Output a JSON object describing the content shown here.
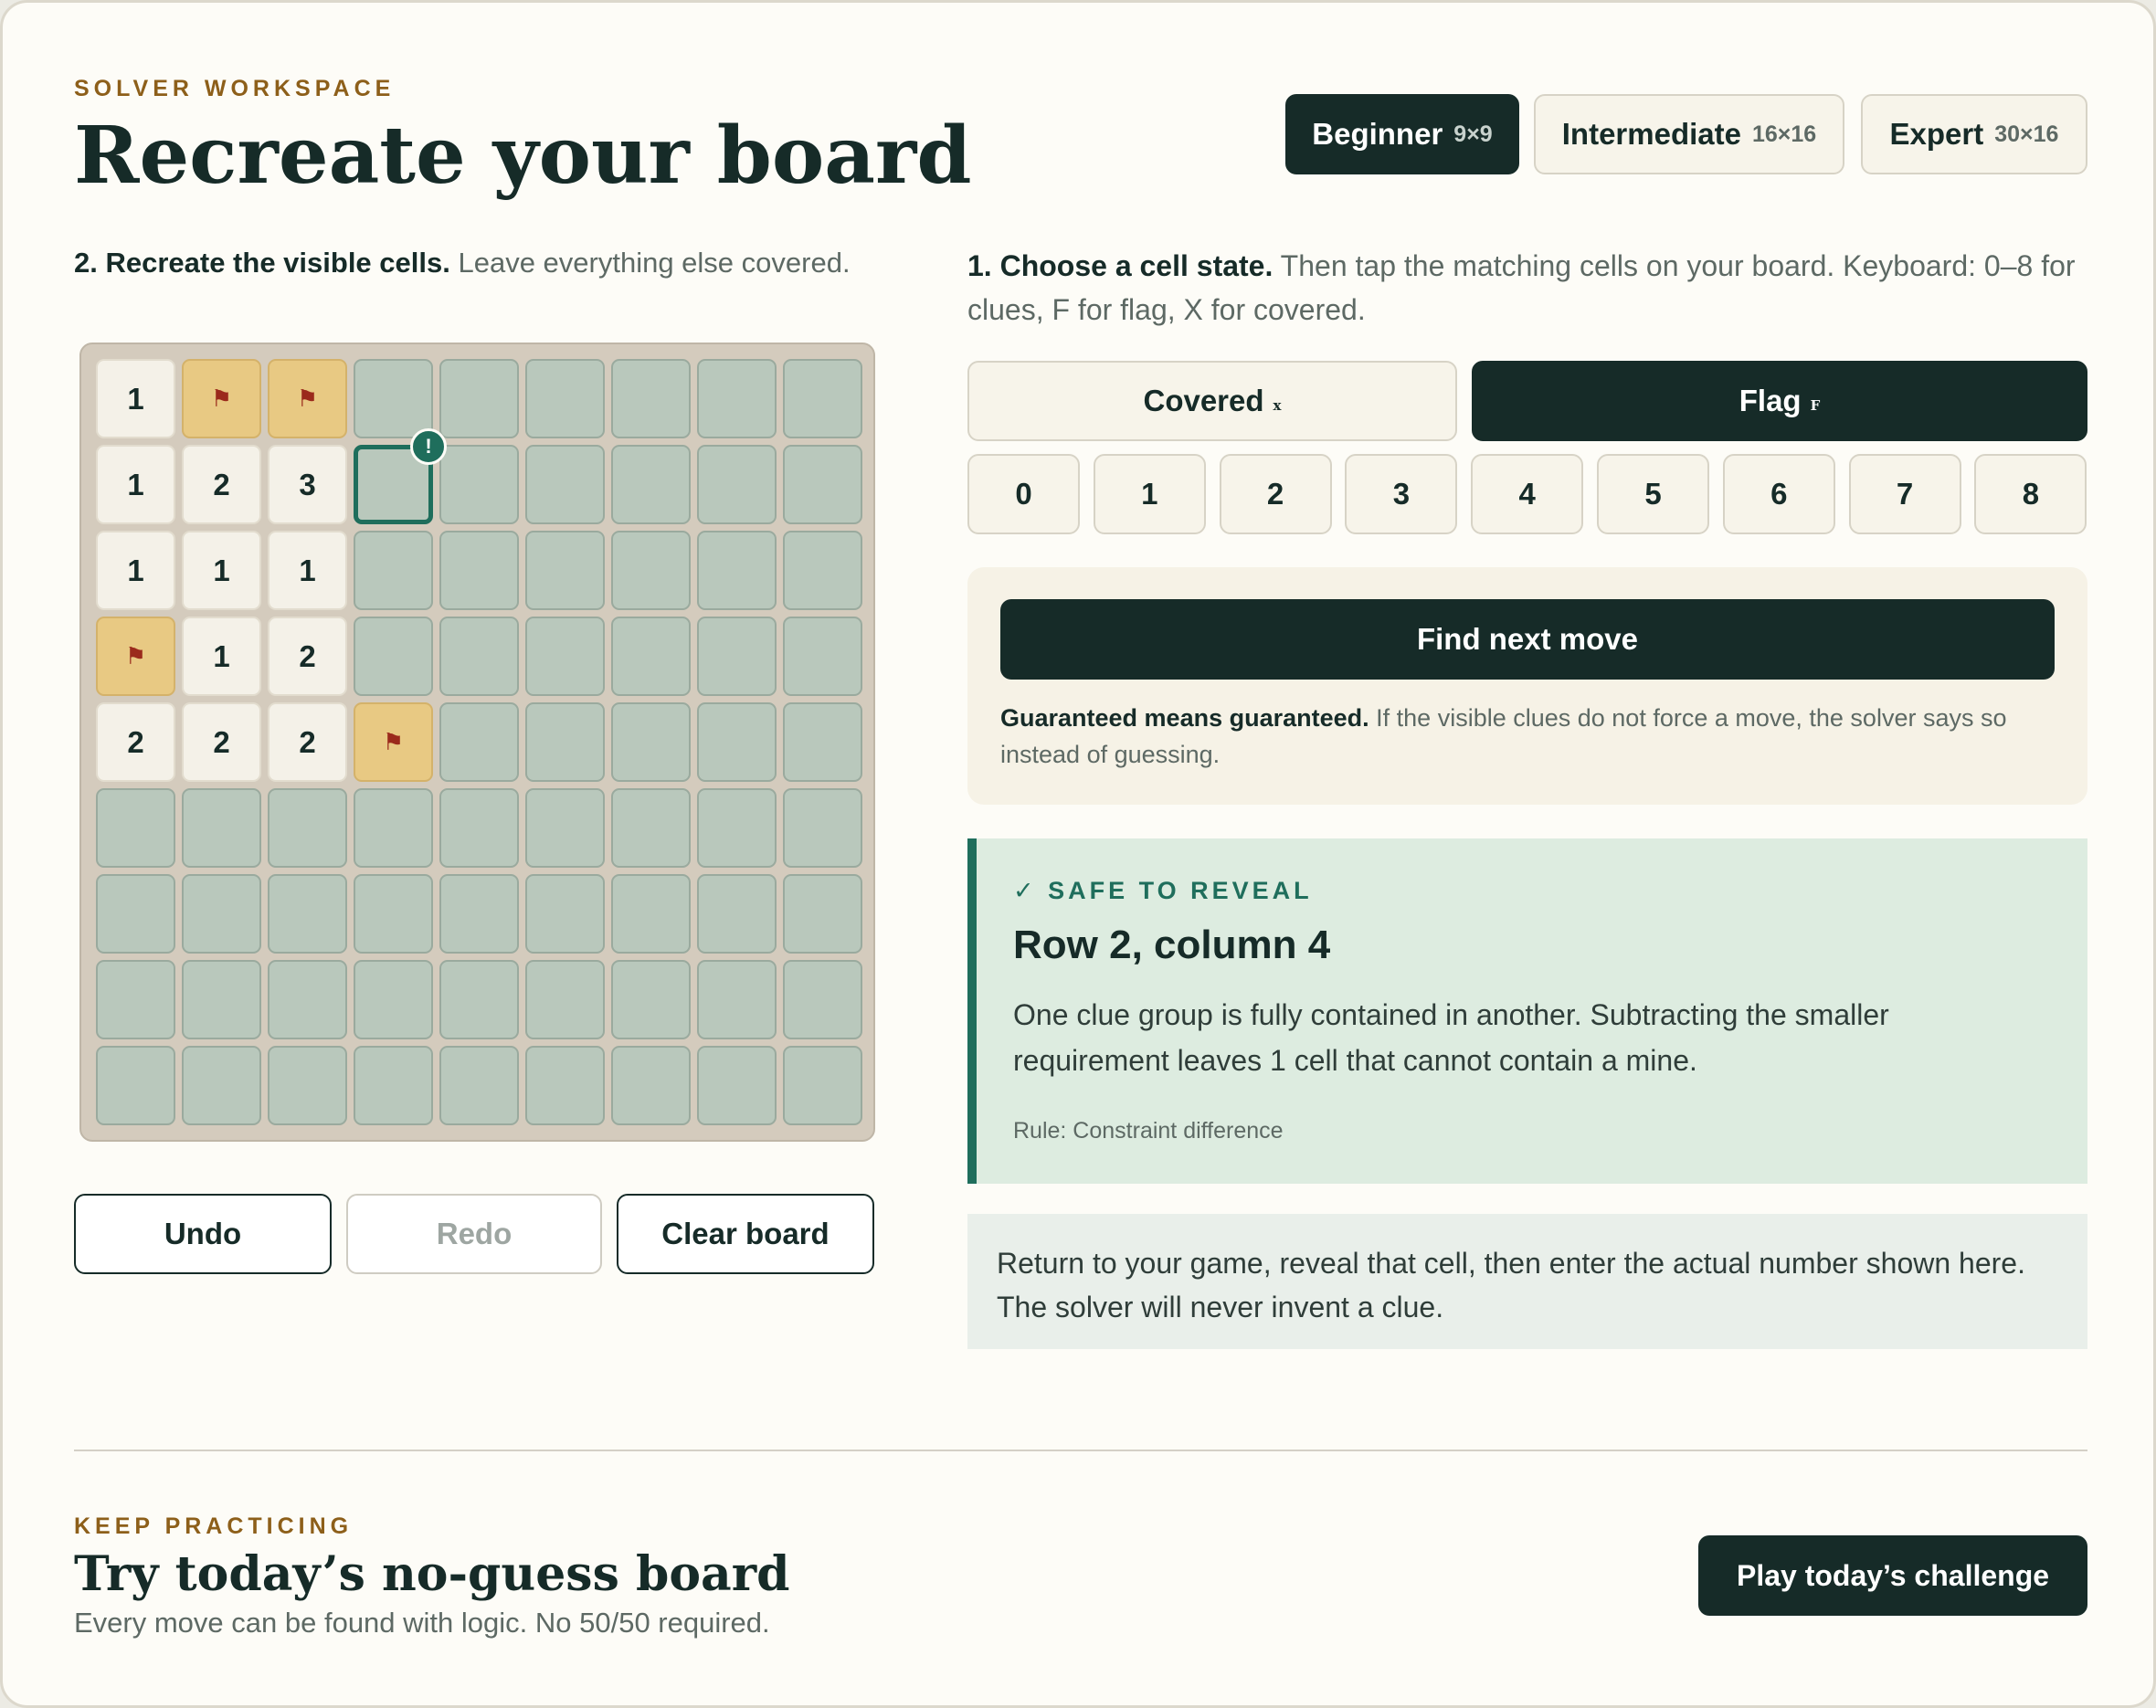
{
  "header": {
    "eyebrow": "SOLVER WORKSPACE",
    "title": "Recreate your board"
  },
  "difficulty": [
    {
      "label": "Beginner",
      "size": "9×9",
      "active": true
    },
    {
      "label": "Intermediate",
      "size": "16×16",
      "active": false
    },
    {
      "label": "Expert",
      "size": "30×16",
      "active": false
    }
  ],
  "step2": {
    "strong": "2. Recreate the visible cells.",
    "text": "Leave everything else covered."
  },
  "board": {
    "rows": [
      [
        "1",
        "F",
        "F",
        "C",
        "C",
        "C",
        "C",
        "C",
        "C"
      ],
      [
        "1",
        "2",
        "3",
        "C",
        "C",
        "C",
        "C",
        "C",
        "C"
      ],
      [
        "1",
        "1",
        "1",
        "C",
        "C",
        "C",
        "C",
        "C",
        "C"
      ],
      [
        "F",
        "1",
        "2",
        "C",
        "C",
        "C",
        "C",
        "C",
        "C"
      ],
      [
        "2",
        "2",
        "2",
        "F",
        "C",
        "C",
        "C",
        "C",
        "C"
      ],
      [
        "C",
        "C",
        "C",
        "C",
        "C",
        "C",
        "C",
        "C",
        "C"
      ],
      [
        "C",
        "C",
        "C",
        "C",
        "C",
        "C",
        "C",
        "C",
        "C"
      ],
      [
        "C",
        "C",
        "C",
        "C",
        "C",
        "C",
        "C",
        "C",
        "C"
      ],
      [
        "C",
        "C",
        "C",
        "C",
        "C",
        "C",
        "C",
        "C",
        "C"
      ]
    ],
    "flag_glyph": "⚑",
    "selected_row": 2,
    "selected_col": 4,
    "marker": "!"
  },
  "actions": {
    "undo": "Undo",
    "redo": "Redo",
    "clear": "Clear board"
  },
  "step1": {
    "strong": "1. Choose a cell state.",
    "text": "Then tap the matching cells on your board. Keyboard: 0–8 for clues, F for flag, X for covered."
  },
  "states": {
    "covered": {
      "label": "Covered",
      "key": "x"
    },
    "flag": {
      "label": "Flag",
      "key": "F"
    }
  },
  "numbers": [
    "0",
    "1",
    "2",
    "3",
    "4",
    "5",
    "6",
    "7",
    "8"
  ],
  "solver": {
    "button": "Find next move",
    "note_strong": "Guaranteed means guaranteed.",
    "note": "If the visible clues do not force a move, the solver says so instead of guessing."
  },
  "result": {
    "check_icon": "✓",
    "tag": "SAFE TO REVEAL",
    "title": "Row 2, column 4",
    "body": "One clue group is fully contained in another. Subtracting the smaller requirement leaves 1 cell that cannot contain a mine.",
    "rule": "Rule: Constraint difference"
  },
  "hint": "Return to your game, reveal that cell, then enter the actual number shown here. The solver will never invent a clue.",
  "footer": {
    "eyebrow": "KEEP PRACTICING",
    "title": "Try today’s no-guess board",
    "subtitle": "Every move can be found with logic. No 50/50 required.",
    "cta": "Play today’s challenge"
  },
  "colors": {
    "dark": "#162b28",
    "accent_green": "#1f6e5c",
    "eyebrow_gold": "#8d5f1a",
    "flag_bg": "#e8c983",
    "covered_bg": "#b9c8bc"
  }
}
